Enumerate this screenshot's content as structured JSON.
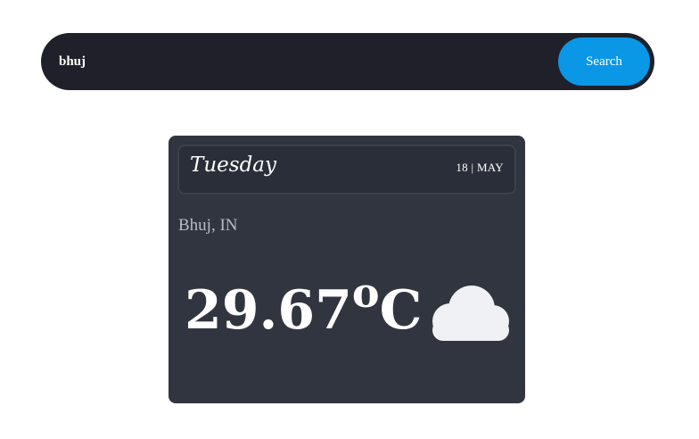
{
  "search": {
    "value": "bhuj",
    "button_label": "Search"
  },
  "weather": {
    "day": "Tuesday",
    "date": "18 | MAY",
    "location": "Bhuj, IN",
    "temperature": "29.67",
    "degree_symbol": "o",
    "unit": "C",
    "condition_icon": "cloud-icon"
  },
  "colors": {
    "search_bar_bg": "#1f2029",
    "search_button_bg": "#0a97e6",
    "card_bg": "#31353f",
    "cloud": "#f0f1f4"
  }
}
